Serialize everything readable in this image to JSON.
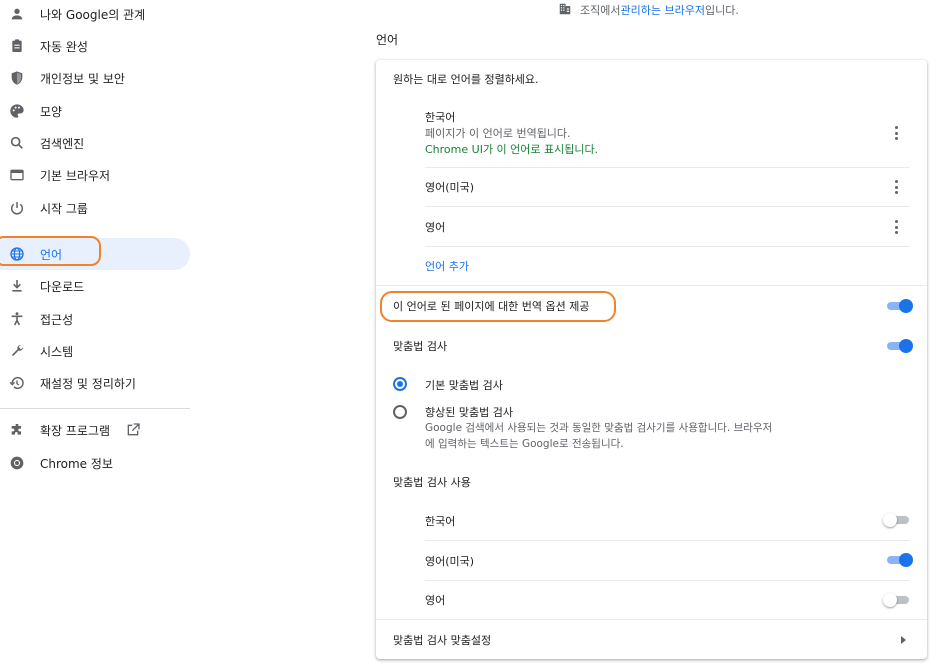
{
  "sidebar": {
    "items": [
      {
        "label": "나와 Google의 관계",
        "icon": "person-icon"
      },
      {
        "label": "자동 완성",
        "icon": "clipboard-icon"
      },
      {
        "label": "개인정보 및 보안",
        "icon": "shield-icon"
      },
      {
        "label": "모양",
        "icon": "palette-icon"
      },
      {
        "label": "검색엔진",
        "icon": "search-icon"
      },
      {
        "label": "기본 브라우저",
        "icon": "browser-icon"
      },
      {
        "label": "시작 그룹",
        "icon": "power-icon"
      },
      {
        "label": "언어",
        "icon": "globe-icon",
        "active": true
      },
      {
        "label": "다운로드",
        "icon": "download-icon"
      },
      {
        "label": "접근성",
        "icon": "accessibility-icon"
      },
      {
        "label": "시스템",
        "icon": "wrench-icon"
      },
      {
        "label": "재설정 및 정리하기",
        "icon": "restore-icon"
      }
    ],
    "extensions_label": "확장 프로그램",
    "about_label": "Chrome 정보"
  },
  "managed": {
    "prefix": "조직에서 ",
    "link": "관리하는 브라우저",
    "suffix": "입니다."
  },
  "section_title": "언어",
  "languages": {
    "header": "원하는 대로 언어를 정렬하세요.",
    "list": [
      {
        "name": "한국어",
        "line1": "페이지가 이 언어로 번역됩니다.",
        "line2": "Chrome UI가 이 언어로 표시됩니다."
      },
      {
        "name": "영어(미국)"
      },
      {
        "name": "영어"
      }
    ],
    "add_label": "언어 추가",
    "offer_translate_label": "이 언어로 된 페이지에 대한 번역 옵션 제공",
    "offer_translate_on": true
  },
  "spellcheck": {
    "label": "맞춤법 검사",
    "enabled": true,
    "basic_label": "기본 맞춤법 검사",
    "enhanced_label": "향상된 맞춤법 검사",
    "enhanced_desc_1": "Google 검색에서 사용되는 것과 동일한 맞춤법 검사기를 사용합니다. 브라우저",
    "enhanced_desc_2": "에 입력하는 텍스트는 Google로 전송됩니다.",
    "use_label": "맞춤법 검사 사용",
    "use_languages": [
      {
        "name": "한국어",
        "on": false
      },
      {
        "name": "영어(미국)",
        "on": true
      },
      {
        "name": "영어",
        "on": false
      }
    ],
    "customize_label": "맞춤법 검사 맞춤설정"
  },
  "colors": {
    "accent": "#1a73e8",
    "annotation": "#f0822d",
    "active_bg": "#e8f0fe",
    "green": "#188038"
  }
}
